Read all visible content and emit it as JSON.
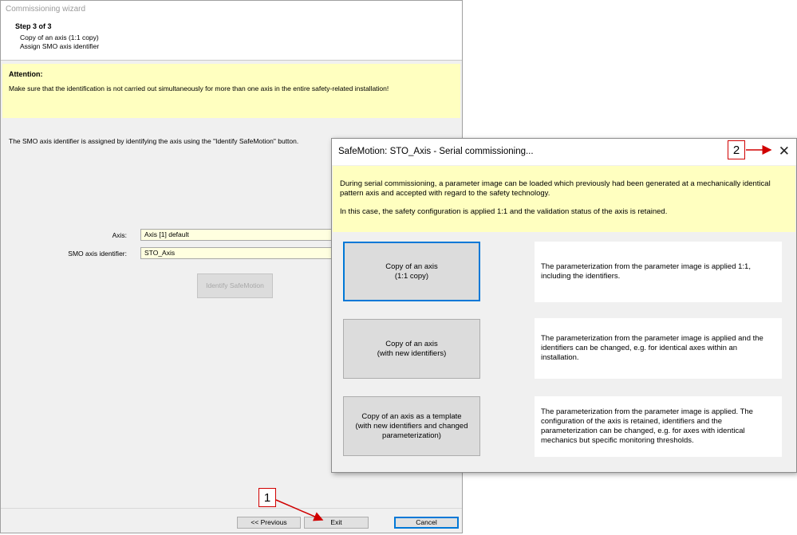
{
  "wizard": {
    "title": "Commissioning wizard",
    "step": "Step 3 of 3",
    "step_lines": [
      "Copy of an axis (1:1 copy)",
      "Assign SMO axis identifier"
    ],
    "attention_title": "Attention:",
    "attention_text": "Make sure that the identification is not carried out simultaneously for more than one axis in the entire safety-related installation!",
    "info_text": "The SMO axis identifier is assigned by identifying the axis using the \"Identify SafeMotion\" button.",
    "axis_label": "Axis:",
    "axis_value": "Axis [1] default",
    "identifier_label": "SMO axis identifier:",
    "identifier_value": "STO_Axis",
    "identify_button": "Identify SafeMotion",
    "previous_button": "<< Previous",
    "exit_button": "Exit",
    "cancel_button": "Cancel"
  },
  "dialog": {
    "title": "SafeMotion: STO_Axis - Serial commissioning...",
    "close_icon": "close-icon",
    "info_1": "During serial commissioning, a parameter image can be loaded which previously had been generated at a mechanically identical pattern axis and accepted with regard to the safety technology.",
    "info_2": "In this case, the safety configuration is applied 1:1 and the validation status of the axis is retained.",
    "options": [
      {
        "label": "Copy of an axis\n(1:1 copy)",
        "description": "The parameterization from the parameter image is applied 1:1, including the identifiers."
      },
      {
        "label": "Copy of an axis\n(with new identifiers)",
        "description": "The parameterization from the parameter image is applied and the identifiers can be changed, e.g. for identical axes within an installation."
      },
      {
        "label": "Copy of an axis as a template\n(with new identifiers and changed parameterization)",
        "description": "The parameterization from the parameter image is applied. The configuration of the axis is retained, identifiers and the parameterization can be changed, e.g. for axes with identical mechanics but specific monitoring thresholds."
      }
    ]
  },
  "callouts": {
    "one": "1",
    "two": "2"
  },
  "colors": {
    "callout_red": "#d00000",
    "attention_yellow": "#ffffc0",
    "focus_blue": "#0078d7"
  }
}
